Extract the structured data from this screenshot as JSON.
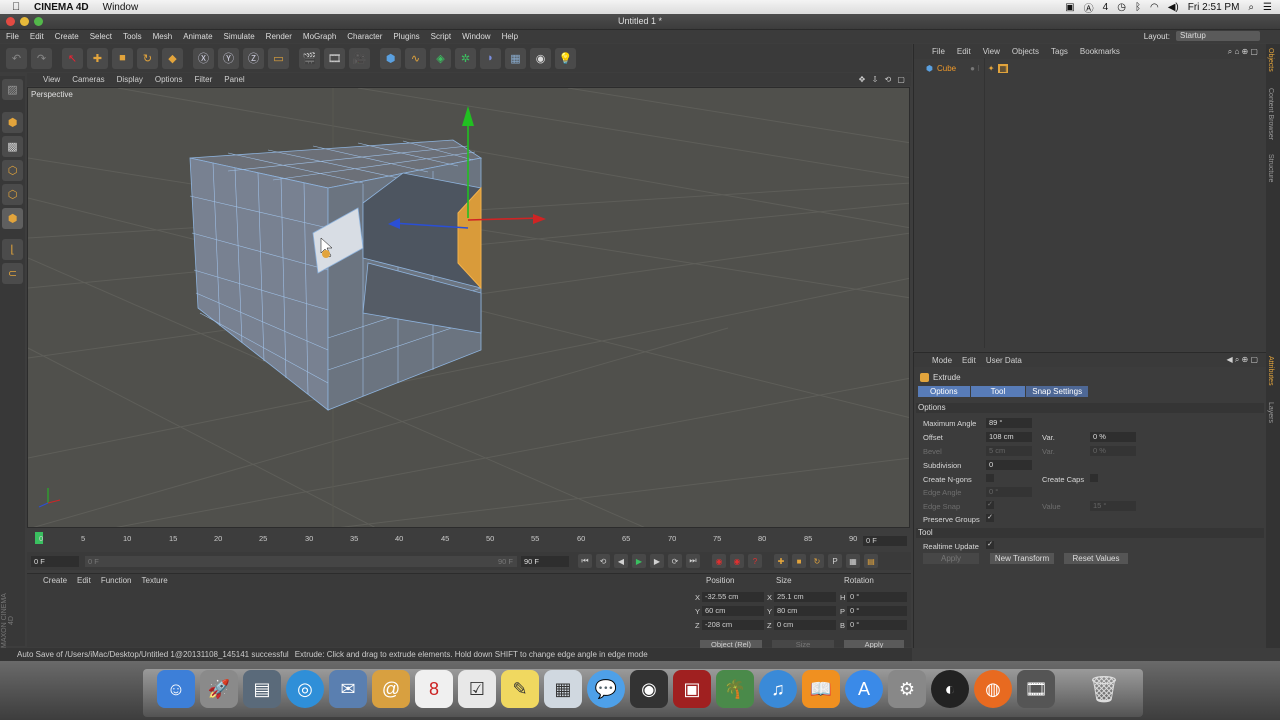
{
  "mac_menubar": {
    "app_name": "CINEMA 4D",
    "menus": [
      "Window"
    ],
    "status_icons": [
      "4"
    ],
    "clock": "Fri 2:51 PM"
  },
  "window": {
    "title": "Untitled 1 *"
  },
  "app_menu": {
    "items": [
      "File",
      "Edit",
      "Create",
      "Select",
      "Tools",
      "Mesh",
      "Animate",
      "Simulate",
      "Render",
      "MoGraph",
      "Character",
      "Plugins",
      "Script",
      "Window",
      "Help"
    ],
    "layout_label": "Layout:",
    "layout_value": "Startup"
  },
  "viewport": {
    "menus": [
      "View",
      "Cameras",
      "Display",
      "Options",
      "Filter",
      "Panel"
    ],
    "camera_label": "Perspective"
  },
  "timeline": {
    "ticks": [
      "0",
      "5",
      "10",
      "15",
      "20",
      "25",
      "30",
      "35",
      "40",
      "45",
      "50",
      "55",
      "60",
      "65",
      "70",
      "75",
      "80",
      "85",
      "90"
    ],
    "end_field": "0 F",
    "current_frame": "0 F",
    "start_field": "0 F",
    "range_end": "90 F",
    "max_frame": "90 F"
  },
  "material_panel": {
    "menus": [
      "Create",
      "Edit",
      "Function",
      "Texture"
    ]
  },
  "coordinates": {
    "headers": [
      "Position",
      "Size",
      "Rotation"
    ],
    "rows": [
      {
        "axis": "X",
        "pos": "-32.55 cm",
        "saxis": "X",
        "size": "25.1 cm",
        "raxis": "H",
        "rot": "0 °"
      },
      {
        "axis": "Y",
        "pos": "60 cm",
        "saxis": "Y",
        "size": "80 cm",
        "raxis": "P",
        "rot": "0 °"
      },
      {
        "axis": "Z",
        "pos": "-208 cm",
        "saxis": "Z",
        "size": "0 cm",
        "raxis": "B",
        "rot": "0 °"
      }
    ],
    "mode_select": "Object (Rel)",
    "size_select": "Size",
    "apply_label": "Apply"
  },
  "statusbar": {
    "autosave": "Auto Save of /Users/iMac/Desktop/Untitled 1@20131108_145141 successful",
    "hint": "Extrude: Click and drag to extrude elements. Hold down SHIFT to change edge angle in edge mode"
  },
  "object_manager": {
    "menus": [
      "File",
      "Edit",
      "View",
      "Objects",
      "Tags",
      "Bookmarks"
    ],
    "objects": [
      {
        "name": "Cube"
      }
    ]
  },
  "side_tabs": [
    "Objects",
    "Content Browser",
    "Structure",
    "Attributes",
    "Layers"
  ],
  "attribute_manager": {
    "menus": [
      "Mode",
      "Edit",
      "User Data"
    ],
    "tool_name": "Extrude",
    "tabs": [
      "Options",
      "Tool",
      "Snap Settings"
    ],
    "section_options": "Options",
    "section_tool": "Tool",
    "fields": {
      "max_angle_label": "Maximum Angle",
      "max_angle": "89 °",
      "offset_label": "Offset",
      "offset": "108 cm",
      "var_label": "Var.",
      "offset_var": "0 %",
      "bevel_label": "Bevel",
      "bevel": "5 cm",
      "bevel_var": "0 %",
      "subdivision_label": "Subdivision",
      "subdivision": "0",
      "create_ngons_label": "Create N-gons",
      "create_caps_label": "Create Caps",
      "edge_angle_label": "Edge Angle",
      "edge_angle": "0 °",
      "edge_snap_label": "Edge Snap",
      "edge_snap_check": "✓",
      "value_label": "Value",
      "value": "15 °",
      "preserve_groups_label": "Preserve Groups",
      "preserve_groups_check": "✓",
      "realtime_update_label": "Realtime Update",
      "realtime_update_check": "✓"
    },
    "buttons": {
      "apply": "Apply",
      "new_transform": "New Transform",
      "reset_values": "Reset Values"
    }
  },
  "colors": {
    "selection_orange": "#f09a2a",
    "tab_blue": "#587cb8",
    "axis_green": "#21c021",
    "axis_red": "#d02424",
    "axis_blue": "#2a4fd6"
  }
}
